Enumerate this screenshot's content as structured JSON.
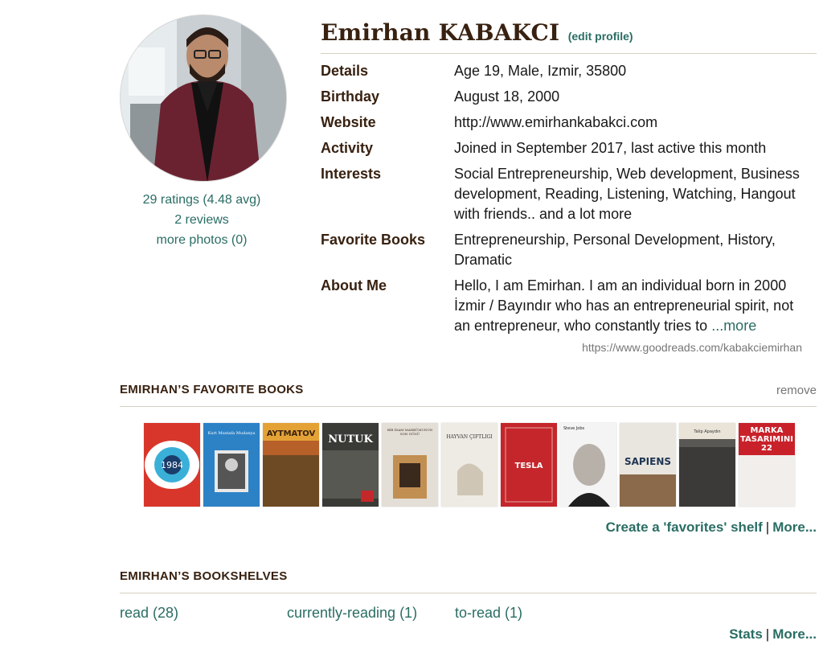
{
  "profile": {
    "name": "Emirhan KABAKCI",
    "edit_label": "(edit profile)",
    "ratings_link": "29 ratings (4.48 avg)",
    "reviews_link": "2 reviews",
    "photos_link": "more photos (0)",
    "url": "https://www.goodreads.com/kabakciemirhan"
  },
  "details": {
    "details": {
      "label": "Details",
      "value": "Age 19, Male, Izmir, 35800"
    },
    "birthday": {
      "label": "Birthday",
      "value": "August 18, 2000"
    },
    "website": {
      "label": "Website",
      "value": "http://www.emirhankabakci.com"
    },
    "activity": {
      "label": "Activity",
      "value": "Joined in September 2017, last active this month"
    },
    "interests": {
      "label": "Interests",
      "value": "Social Entrepreneurship, Web development, Business development, Reading, Listening, Watching, Hangout with friends.. and a lot more"
    },
    "favorite_books": {
      "label": "Favorite Books",
      "value": "Entrepreneurship, Personal Development, History, Dramatic"
    },
    "about": {
      "label": "About Me",
      "value": "Hello, I am Emirhan. I am an individual born in 2000 İzmir / Bayındır who has an entrepreneurial spirit, not an entrepreneur, who constantly tries to ",
      "more": "...more"
    }
  },
  "favorites": {
    "title": "EMIRHAN’S FAVORITE BOOKS",
    "remove": "remove",
    "create_shelf": "Create a 'favorites' shelf",
    "more": "More...",
    "covers": [
      {
        "text": "1984",
        "bg": "#d9362b"
      },
      {
        "text": "Kurt Mustafa Mudanya",
        "bg": "#2d82c6"
      },
      {
        "text": "AYTMATOV",
        "bg": "#b7602a"
      },
      {
        "text": "NUTUK",
        "bg": "#3a3a36"
      },
      {
        "text": "BİR İDAM MAHKÛMUNUN SON GÜNÜ",
        "bg": "#e3ded6"
      },
      {
        "text": "HAYVAN ÇİFTLİĞİ",
        "bg": "#eeebe4"
      },
      {
        "text": "TESLA",
        "bg": "#c5262b"
      },
      {
        "text": "Steve Jobs",
        "bg": "#f4f4f4"
      },
      {
        "text": "SAPIENS",
        "bg": "#e9e6df"
      },
      {
        "text": "Talip Apaydın",
        "bg": "#5a5854"
      },
      {
        "text": "MARKA TASARIMININ 22",
        "bg": "#f1eeeb"
      }
    ]
  },
  "bookshelves": {
    "title": "EMIRHAN’S BOOKSHELVES",
    "read": "read (28)",
    "currently_reading": "currently-reading (1)",
    "to_read": "to-read (1)",
    "stats": "Stats",
    "more": "More..."
  },
  "colors": {
    "link": "#2a6d64",
    "heading": "#382110",
    "rule": "#d6d0c4",
    "muted": "#767676"
  }
}
